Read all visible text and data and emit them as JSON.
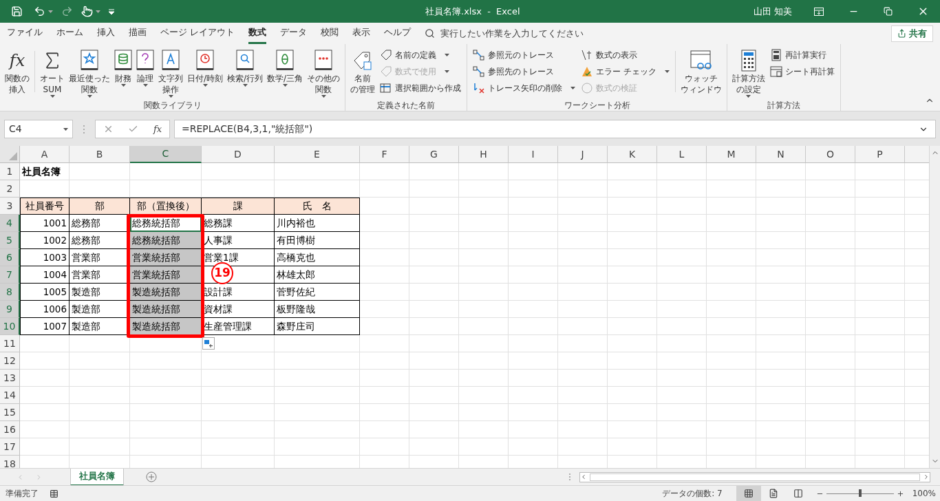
{
  "title_bar": {
    "title": "社員名簿.xlsx  -  Excel",
    "user": "山田 知美"
  },
  "tabs": [
    {
      "label": "ファイル",
      "selected": false
    },
    {
      "label": "ホーム",
      "selected": false
    },
    {
      "label": "挿入",
      "selected": false
    },
    {
      "label": "描画",
      "selected": false
    },
    {
      "label": "ページ レイアウト",
      "selected": false
    },
    {
      "label": "数式",
      "selected": true
    },
    {
      "label": "データ",
      "selected": false
    },
    {
      "label": "校閲",
      "selected": false
    },
    {
      "label": "表示",
      "selected": false
    },
    {
      "label": "ヘルプ",
      "selected": false
    }
  ],
  "search": {
    "placeholder": "実行したい作業を入力してください"
  },
  "share_button": "共有",
  "ribbon_groups": [
    {
      "label": "関数ライブラリ",
      "items": [
        {
          "kind": "large",
          "icon_text": "fx",
          "lines": [
            "関数の",
            "挿入"
          ],
          "dropdown": false,
          "disabled": false
        },
        {
          "kind": "separator"
        },
        {
          "kind": "large",
          "lines": [
            "オート",
            "SUM"
          ],
          "dropdown": true,
          "disabled": false
        },
        {
          "kind": "large",
          "lines": [
            "最近使った",
            "関数"
          ],
          "dropdown": true,
          "disabled": false
        },
        {
          "kind": "large",
          "lines": [
            "財務"
          ],
          "dropdown": true,
          "disabled": false
        },
        {
          "kind": "large",
          "lines": [
            "論理"
          ],
          "dropdown": true,
          "disabled": false
        },
        {
          "kind": "large",
          "lines": [
            "文字列",
            "操作"
          ],
          "dropdown": true,
          "disabled": false
        },
        {
          "kind": "large",
          "lines": [
            "日付/時刻"
          ],
          "dropdown": true,
          "disabled": false
        },
        {
          "kind": "large",
          "lines": [
            "検索/行列"
          ],
          "dropdown": true,
          "disabled": false
        },
        {
          "kind": "large",
          "lines": [
            "数学/三角"
          ],
          "dropdown": true,
          "disabled": false
        },
        {
          "kind": "large",
          "lines": [
            "その他の",
            "関数"
          ],
          "dropdown": true,
          "disabled": false
        }
      ]
    },
    {
      "label": "定義された名前",
      "items": [
        {
          "kind": "large",
          "lines": [
            "名前",
            "の管理"
          ],
          "dropdown": false,
          "disabled": false
        },
        {
          "kind": "small",
          "label": "名前の定義",
          "dropdown": true,
          "disabled": false
        },
        {
          "kind": "small",
          "label": "数式で使用",
          "dropdown": true,
          "disabled": true
        },
        {
          "kind": "small",
          "label": "選択範囲から作成",
          "dropdown": false,
          "disabled": false
        }
      ]
    },
    {
      "label": "ワークシート分析",
      "items": [
        {
          "kind": "small",
          "label": "参照元のトレース",
          "dropdown": false,
          "disabled": false
        },
        {
          "kind": "small",
          "label": "参照先のトレース",
          "dropdown": false,
          "disabled": false
        },
        {
          "kind": "small",
          "label": "トレース矢印の削除",
          "dropdown": true,
          "disabled": false
        },
        {
          "kind": "small",
          "label": "数式の表示",
          "dropdown": false,
          "disabled": false
        },
        {
          "kind": "small",
          "label": "エラー チェック",
          "dropdown": true,
          "disabled": false
        },
        {
          "kind": "small",
          "label": "数式の検証",
          "dropdown": false,
          "disabled": true
        },
        {
          "kind": "separator"
        },
        {
          "kind": "large",
          "lines": [
            "ウォッチ",
            "ウィンドウ"
          ],
          "dropdown": false,
          "disabled": false
        }
      ]
    },
    {
      "label": "計算方法",
      "items": [
        {
          "kind": "large",
          "lines": [
            "計算方法",
            "の設定"
          ],
          "dropdown": true,
          "disabled": false
        },
        {
          "kind": "small",
          "label": "再計算実行",
          "dropdown": false,
          "disabled": false
        },
        {
          "kind": "small",
          "label": "シート再計算",
          "dropdown": false,
          "disabled": false
        }
      ]
    }
  ],
  "formula_bar": {
    "name_box": "C4",
    "function_button": "fx",
    "formula": "=REPLACE(B4,3,1,\"統括部\")"
  },
  "columns": [
    {
      "label": "A",
      "selected": false
    },
    {
      "label": "B",
      "selected": false
    },
    {
      "label": "C",
      "selected": true
    },
    {
      "label": "D",
      "selected": false
    },
    {
      "label": "E",
      "selected": false
    },
    {
      "label": "F",
      "selected": false
    },
    {
      "label": "G",
      "selected": false
    },
    {
      "label": "H",
      "selected": false
    },
    {
      "label": "I",
      "selected": false
    },
    {
      "label": "J",
      "selected": false
    },
    {
      "label": "K",
      "selected": false
    },
    {
      "label": "L",
      "selected": false
    },
    {
      "label": "M",
      "selected": false
    },
    {
      "label": "N",
      "selected": false
    },
    {
      "label": "O",
      "selected": false
    },
    {
      "label": "P",
      "selected": false
    }
  ],
  "rows": [
    {
      "label": "1",
      "selected": false,
      "cells": [
        {
          "kind": "title",
          "text": "社員名簿"
        }
      ]
    },
    {
      "label": "2",
      "selected": false
    },
    {
      "label": "3",
      "selected": false,
      "cells": [
        {
          "kind": "header",
          "text": "社員番号"
        },
        {
          "kind": "header",
          "text": "部"
        },
        {
          "kind": "header",
          "text": "部（置換後）"
        },
        {
          "kind": "header",
          "text": "課"
        },
        {
          "kind": "header",
          "text": "氏　名"
        }
      ]
    },
    {
      "label": "4",
      "selected": true,
      "cells": [
        {
          "kind": "number",
          "text": "1001"
        },
        {
          "kind": "text",
          "text": "総務部"
        },
        {
          "kind": "text",
          "text": "総務統括部",
          "active": true
        },
        {
          "kind": "text",
          "text": "総務課"
        },
        {
          "kind": "text",
          "text": "川内裕也"
        }
      ]
    },
    {
      "label": "5",
      "selected": true,
      "cells": [
        {
          "kind": "number",
          "text": "1002"
        },
        {
          "kind": "text",
          "text": "総務部"
        },
        {
          "kind": "text",
          "text": "総務統括部"
        },
        {
          "kind": "text",
          "text": "人事課"
        },
        {
          "kind": "text",
          "text": "有田博樹"
        }
      ]
    },
    {
      "label": "6",
      "selected": true,
      "cells": [
        {
          "kind": "number",
          "text": "1003"
        },
        {
          "kind": "text",
          "text": "営業部"
        },
        {
          "kind": "text",
          "text": "営業統括部"
        },
        {
          "kind": "text",
          "text": "営業1課"
        },
        {
          "kind": "text",
          "text": "高橋克也"
        }
      ]
    },
    {
      "label": "7",
      "selected": true,
      "cells": [
        {
          "kind": "number",
          "text": "1004"
        },
        {
          "kind": "text",
          "text": "営業部"
        },
        {
          "kind": "text",
          "text": "営業統括部"
        },
        {
          "kind": "text"
        },
        {
          "kind": "text",
          "text": "林雄太郎"
        }
      ]
    },
    {
      "label": "8",
      "selected": true,
      "cells": [
        {
          "kind": "number",
          "text": "1005"
        },
        {
          "kind": "text",
          "text": "製造部"
        },
        {
          "kind": "text",
          "text": "製造統括部"
        },
        {
          "kind": "text",
          "text": "設計課"
        },
        {
          "kind": "text",
          "text": "菅野佐紀"
        }
      ]
    },
    {
      "label": "9",
      "selected": true,
      "cells": [
        {
          "kind": "number",
          "text": "1006"
        },
        {
          "kind": "text",
          "text": "製造部"
        },
        {
          "kind": "text",
          "text": "製造統括部"
        },
        {
          "kind": "text",
          "text": "資材課"
        },
        {
          "kind": "text",
          "text": "板野隆哉"
        }
      ]
    },
    {
      "label": "10",
      "selected": true,
      "cells": [
        {
          "kind": "number",
          "text": "1007"
        },
        {
          "kind": "text",
          "text": "製造部"
        },
        {
          "kind": "text",
          "text": "製造統括部"
        },
        {
          "kind": "text",
          "text": "生産管理課"
        },
        {
          "kind": "text",
          "text": "森野庄司"
        }
      ]
    },
    {
      "label": "11",
      "selected": false
    },
    {
      "label": "12",
      "selected": false
    },
    {
      "label": "13",
      "selected": false
    },
    {
      "label": "14",
      "selected": false
    },
    {
      "label": "15",
      "selected": false
    },
    {
      "label": "16",
      "selected": false
    },
    {
      "label": "17",
      "selected": false
    },
    {
      "label": "18",
      "selected": false
    }
  ],
  "callout": {
    "label": "19"
  },
  "sheet_tabs": [
    {
      "label": "社員名簿",
      "selected": true
    }
  ],
  "status_bar": {
    "status": "準備完了",
    "count": "データの個数: 7",
    "views": [
      {
        "selected": true
      },
      {
        "selected": false
      },
      {
        "selected": false
      }
    ],
    "zoom": {
      "level": 0.5,
      "label": "100%"
    }
  }
}
